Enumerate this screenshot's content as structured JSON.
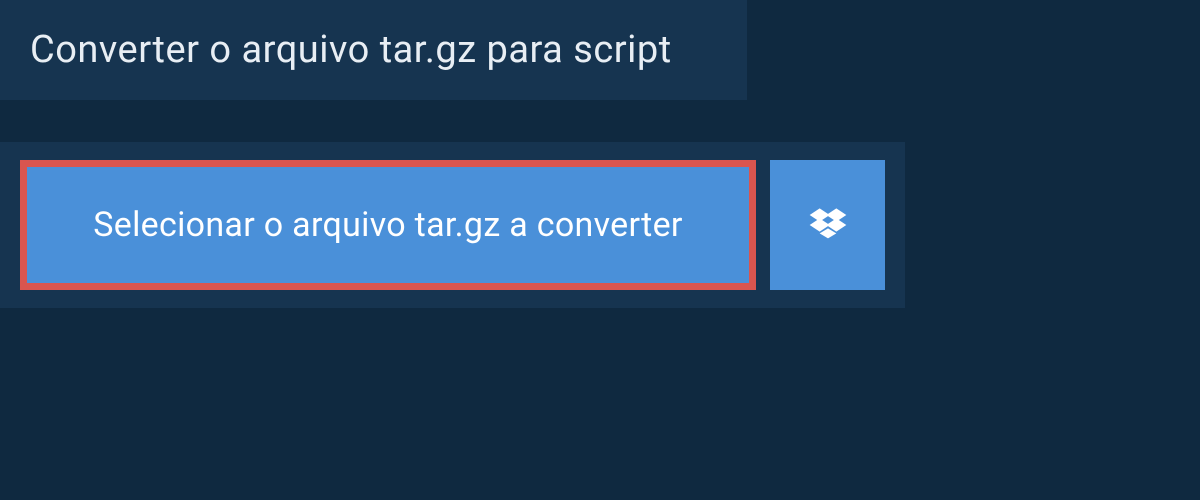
{
  "header": {
    "title": "Converter o arquivo tar.gz para script"
  },
  "upload": {
    "select_button_label": "Selecionar o arquivo tar.gz a converter",
    "dropbox_icon_name": "dropbox-icon"
  },
  "colors": {
    "background": "#0f2940",
    "panel": "#163450",
    "button_primary": "#4a90d9",
    "highlight_border": "#d9554f",
    "text_light": "#e8eef4"
  }
}
